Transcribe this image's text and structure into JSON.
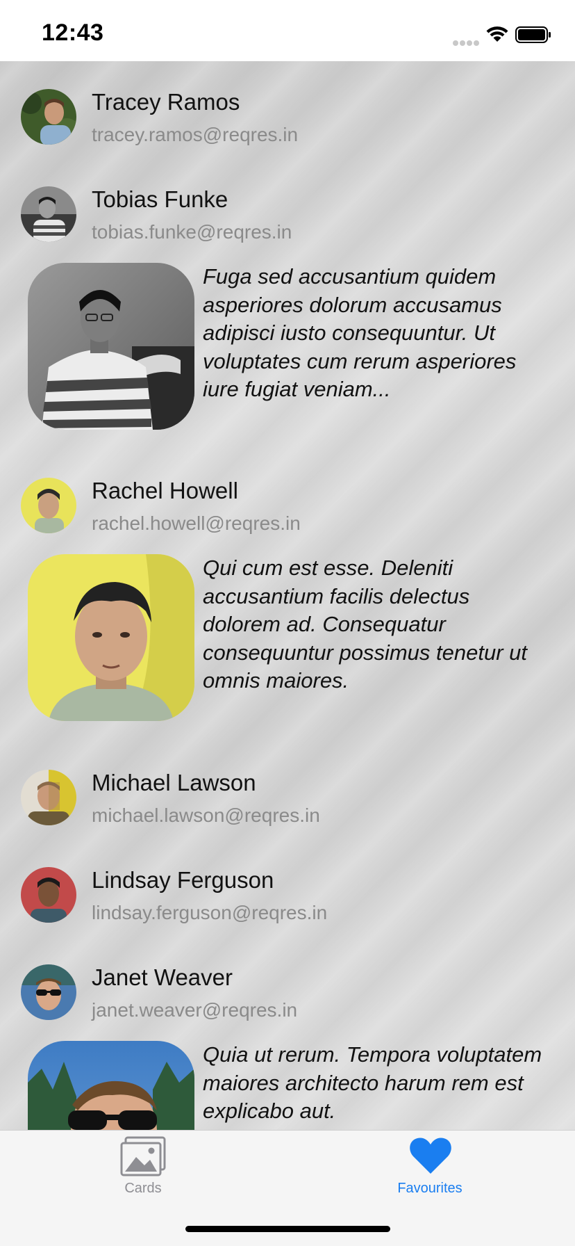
{
  "status_bar": {
    "time": "12:43",
    "icons": [
      "cellular-signal-icon",
      "wifi-icon",
      "battery-icon"
    ]
  },
  "users": [
    {
      "name": "Tracey Ramos",
      "email": "tracey.ramos@reqres.in",
      "avatar_colors": [
        "#3f5b2a",
        "#8fb0cf",
        "#c99a7a"
      ]
    },
    {
      "name": "Tobias Funke",
      "email": "tobias.funke@reqres.in",
      "avatar_colors": [
        "#6d6d6d",
        "#d8d8d8",
        "#2b2b2b"
      ],
      "description": "Fuga sed accusantium quidem asperiores dolorum accusamus adipisci iusto consequuntur. Ut voluptates cum rerum asperiores iure fugiat veniam..."
    },
    {
      "name": "Rachel Howell",
      "email": "rachel.howell@reqres.in",
      "avatar_colors": [
        "#e8e35a",
        "#c9a080",
        "#2a2a2a"
      ],
      "description": "Qui cum est esse. Deleniti accusantium facilis delectus dolorem ad. Consequatur consequuntur possimus tenetur ut omnis maiores."
    },
    {
      "name": "Michael Lawson",
      "email": "michael.lawson@reqres.in",
      "avatar_colors": [
        "#d8c7b2",
        "#d8c430",
        "#6b5a3a"
      ]
    },
    {
      "name": "Lindsay Ferguson",
      "email": "lindsay.ferguson@reqres.in",
      "avatar_colors": [
        "#c24a4a",
        "#6b4a34",
        "#2a2a2a"
      ]
    },
    {
      "name": "Janet Weaver",
      "email": "janet.weaver@reqres.in",
      "avatar_colors": [
        "#4a7ab0",
        "#d9a888",
        "#1b1b1b"
      ],
      "description": "Quia ut rerum. Tempora voluptatem maiores architecto harum rem est explicabo aut."
    }
  ],
  "tab_bar": {
    "tabs": [
      {
        "label": "Cards",
        "icon": "photo-icon",
        "color": "#8e8e93",
        "selected": false
      },
      {
        "label": "Favourites",
        "icon": "heart-icon",
        "color": "#1a7ef0",
        "selected": true
      }
    ]
  },
  "colors": {
    "accent": "#1a7ef0",
    "inactive": "#8e8e93",
    "email_text": "#8a8a8a"
  }
}
